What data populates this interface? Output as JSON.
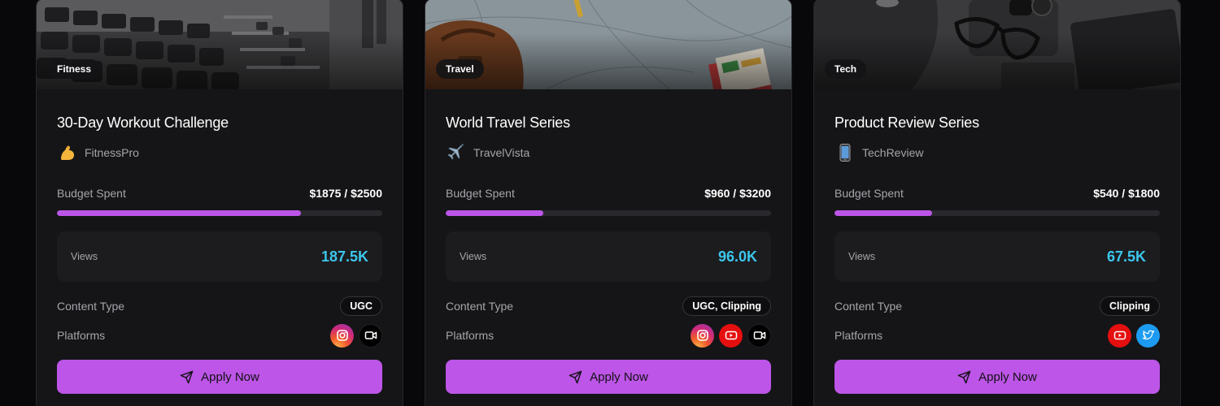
{
  "campaigns": [
    {
      "category": "Fitness",
      "title": "30-Day Workout Challenge",
      "brand_emoji": "💪",
      "brand": "FitnessPro",
      "budget_label": "Budget Spent",
      "budget_value": "$1875 / $2500",
      "budget_fraction": 0.75,
      "views_label": "Views",
      "views_value": "187.5K",
      "content_type_label": "Content Type",
      "content_type": "UGC",
      "platforms_label": "Platforms",
      "platforms": [
        "instagram-icon",
        "video-icon"
      ],
      "apply_label": "Apply Now"
    },
    {
      "category": "Travel",
      "title": "World Travel Series",
      "brand_emoji": "✈️",
      "brand": "TravelVista",
      "budget_label": "Budget Spent",
      "budget_value": "$960 / $3200",
      "budget_fraction": 0.3,
      "views_label": "Views",
      "views_value": "96.0K",
      "content_type_label": "Content Type",
      "content_type": "UGC, Clipping",
      "platforms_label": "Platforms",
      "platforms": [
        "instagram-icon",
        "youtube-icon",
        "video-icon"
      ],
      "apply_label": "Apply Now"
    },
    {
      "category": "Tech",
      "title": "Product Review Series",
      "brand_emoji": "📱",
      "brand": "TechReview",
      "budget_label": "Budget Spent",
      "budget_value": "$540 / $1800",
      "budget_fraction": 0.3,
      "views_label": "Views",
      "views_value": "67.5K",
      "content_type_label": "Content Type",
      "content_type": "Clipping",
      "platforms_label": "Platforms",
      "platforms": [
        "youtube-icon",
        "twitter-icon"
      ],
      "apply_label": "Apply Now"
    }
  ],
  "colors": {
    "accent": "#bd55e8",
    "views": "#3cc6ec",
    "card_bg": "#151517",
    "page_bg": "#08080a"
  }
}
